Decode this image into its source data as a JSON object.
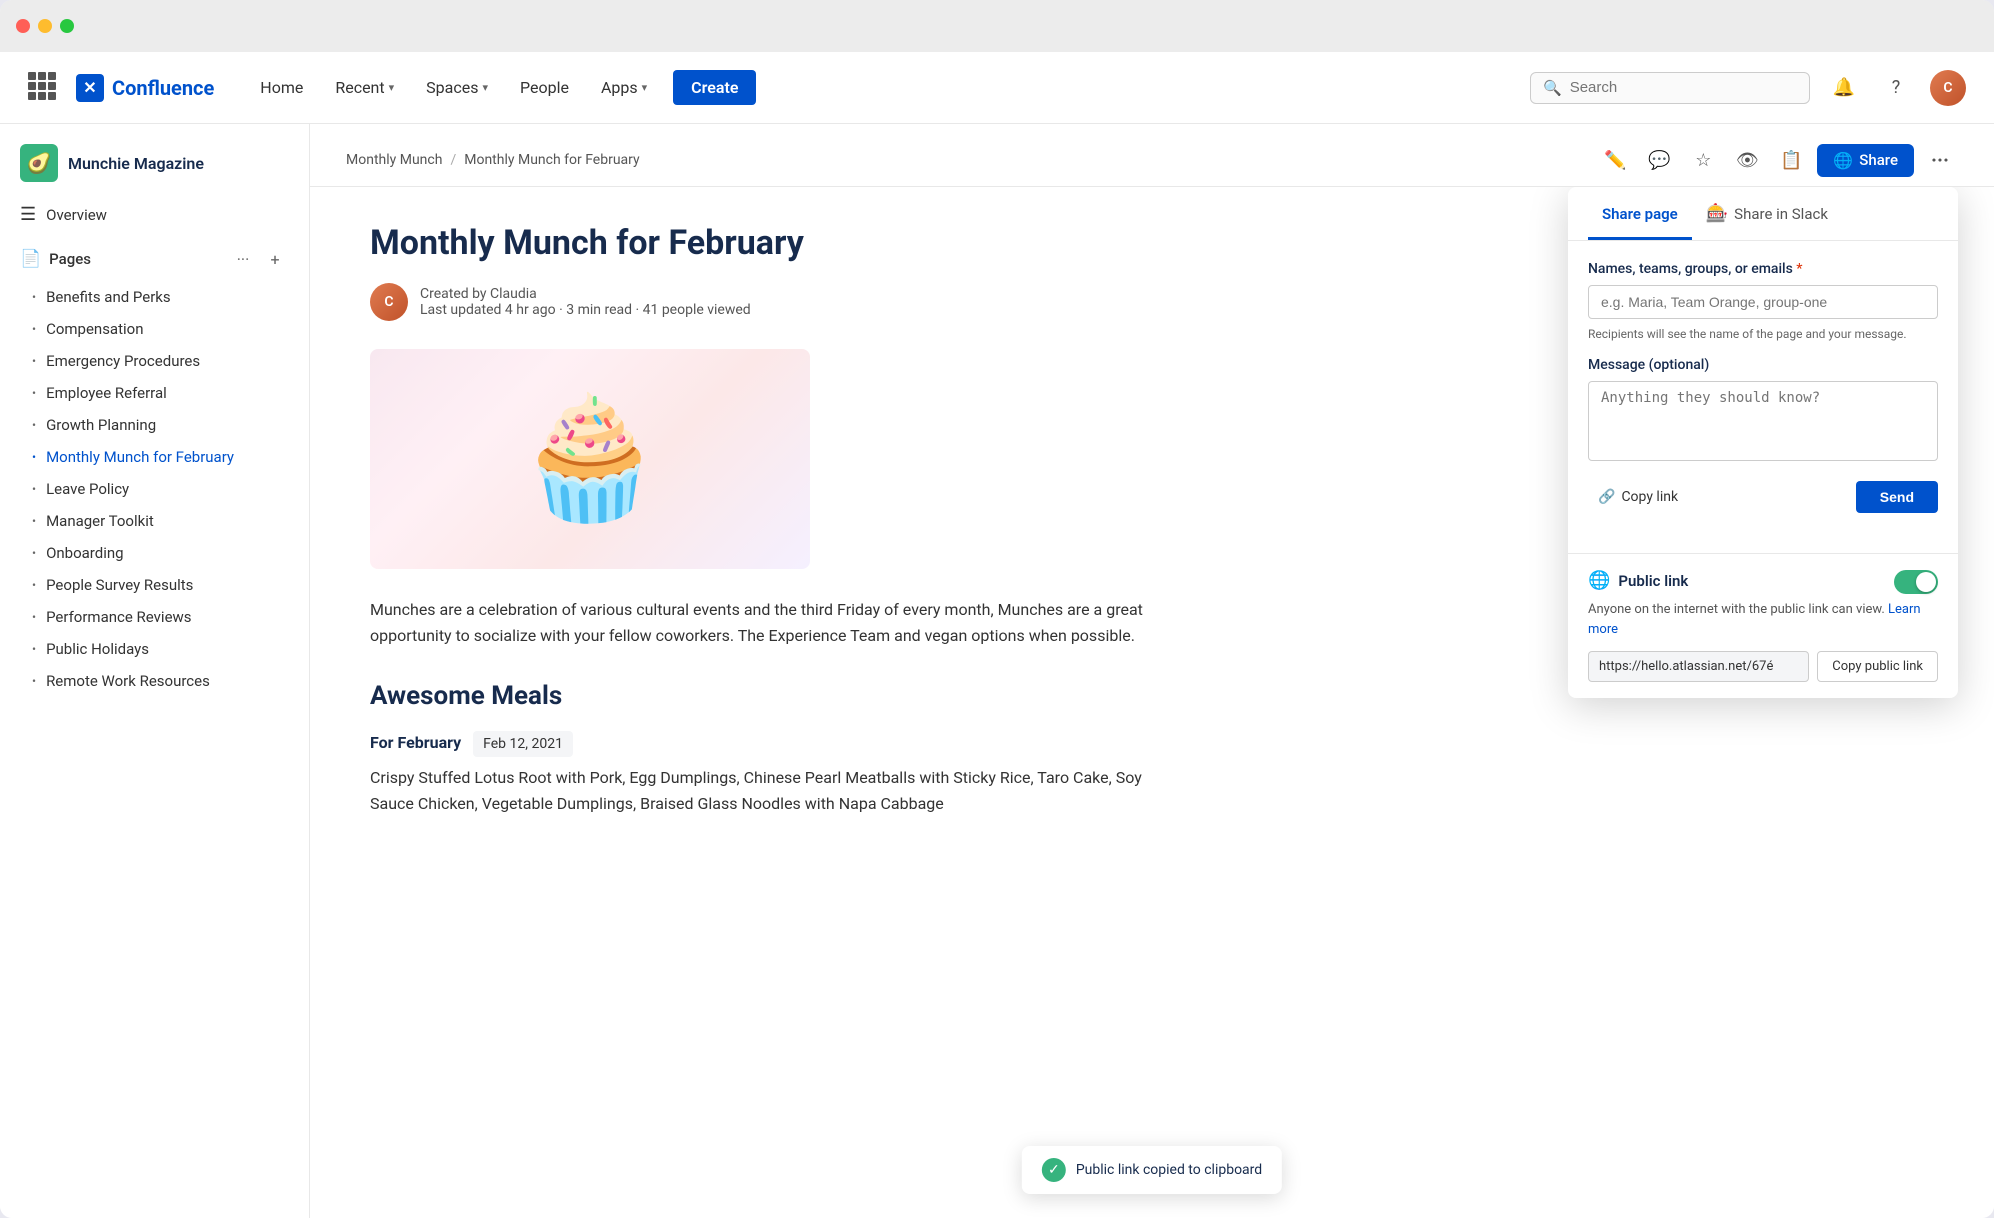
{
  "window": {
    "title": "Confluence"
  },
  "navbar": {
    "logo_text": "Confluence",
    "home_label": "Home",
    "recent_label": "Recent",
    "spaces_label": "Spaces",
    "people_label": "People",
    "apps_label": "Apps",
    "create_label": "Create",
    "search_placeholder": "Search"
  },
  "sidebar": {
    "space_name": "Munchie Magazine",
    "space_emoji": "🥑",
    "overview_label": "Overview",
    "pages_label": "Pages",
    "items": [
      {
        "label": "Benefits and Perks",
        "active": false
      },
      {
        "label": "Compensation",
        "active": false
      },
      {
        "label": "Emergency Procedures",
        "active": false
      },
      {
        "label": "Employee Referral",
        "active": false
      },
      {
        "label": "Growth Planning",
        "active": false
      },
      {
        "label": "Monthly Munch for February",
        "active": true
      },
      {
        "label": "Leave Policy",
        "active": false
      },
      {
        "label": "Manager Toolkit",
        "active": false
      },
      {
        "label": "Onboarding",
        "active": false
      },
      {
        "label": "People Survey Results",
        "active": false
      },
      {
        "label": "Performance Reviews",
        "active": false
      },
      {
        "label": "Public Holidays",
        "active": false
      },
      {
        "label": "Remote Work Resources",
        "active": false
      }
    ]
  },
  "breadcrumb": {
    "parent": "Monthly Munch",
    "current": "Monthly Munch for February"
  },
  "toolbar": {
    "share_label": "Share"
  },
  "page": {
    "title": "Monthly Munch for February",
    "author": "Claudia",
    "created_label": "Created by Claudia",
    "meta": "Last updated 4 hr ago · 3 min read · 41 people viewed",
    "body_text": "Munches are a celebration of various cultural events and the third Friday of every month, Munches are a great opportunity to socialize with your fellow coworkers. The Experience Team and vegan options when possible.",
    "section_title": "Awesome Meals",
    "for_label": "For February",
    "date": "Feb 12, 2021",
    "meals_text": "Crispy Stuffed Lotus Root with Pork, Egg Dumplings, Chinese Pearl Meatballs with Sticky Rice, Taro Cake, Soy Sauce Chicken, Vegetable Dumplings, Braised Glass Noodles with Napa Cabbage"
  },
  "share_panel": {
    "tab_page_label": "Share page",
    "tab_slack_label": "Share in Slack",
    "names_label": "Names, teams, groups, or emails",
    "names_placeholder": "e.g. Maria, Team Orange, group-one",
    "names_hint": "Recipients will see the name of the page and your message.",
    "message_label": "Message (optional)",
    "message_placeholder": "Anything they should know?",
    "copy_link_label": "Copy link",
    "send_label": "Send",
    "public_link_title": "Public link",
    "public_link_desc": "Anyone on the internet with the public link can view.",
    "learn_more_label": "Learn more",
    "public_url": "https://hello.atlassian.net/67é",
    "copy_public_label": "Copy public link",
    "toggle_on": true
  },
  "toast": {
    "message": "Public link copied to clipboard"
  }
}
